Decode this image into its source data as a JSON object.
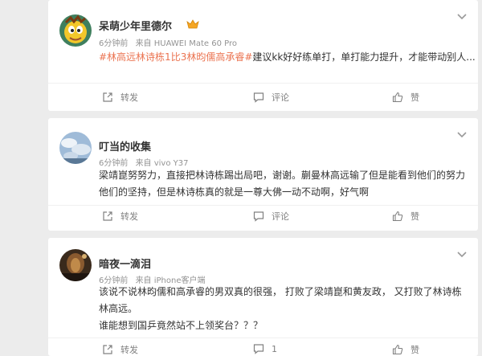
{
  "posts": [
    {
      "user": "呆萌少年里德尔",
      "time": "6分钟前",
      "source": "来自 HUAWEI Mate 60 Pro",
      "hashtag": "#林高远林诗栋1比3林昀儒高承睿#",
      "body": "建议kk好好练单打，单打能力提升，才能带动别人...",
      "actions": {
        "repost": "转发",
        "comment": "评论",
        "like": "赞"
      }
    },
    {
      "user": "叮当的收集",
      "time": "6分钟前",
      "source": "来自 vivo Y37",
      "body_lines": [
        "梁靖崑努努力，直接把林诗栋踢出局吧，谢谢。蒯曼林高远输了但是能看到他们的努力",
        "他们的坚持，但是林诗栋真的就是一尊大佛一动不动啊，好气啊"
      ],
      "actions": {
        "repost": "转发",
        "comment": "评论",
        "like": "赞"
      }
    },
    {
      "user": "暗夜一滴泪",
      "time": "6分钟前",
      "source": "来自 iPhone客户端",
      "body_lines": [
        "该说不说林昀儒和高承睿的男双真的很强， 打败了梁靖崑和黄友政， 又打败了林诗栋",
        "林高远。",
        "谁能想到国乒竟然站不上领奖台？？？"
      ],
      "actions": {
        "repost": "转发",
        "comment": "1",
        "like": "赞"
      }
    }
  ],
  "icons": {
    "repost": "repost-icon",
    "comment": "comment-icon",
    "like": "thumbs-up-icon",
    "more": "chevron-down-icon",
    "badge": "member-badge-icon"
  },
  "colors": {
    "hashtag": "#eb7350",
    "background": "#ececec",
    "card": "#ffffff"
  }
}
